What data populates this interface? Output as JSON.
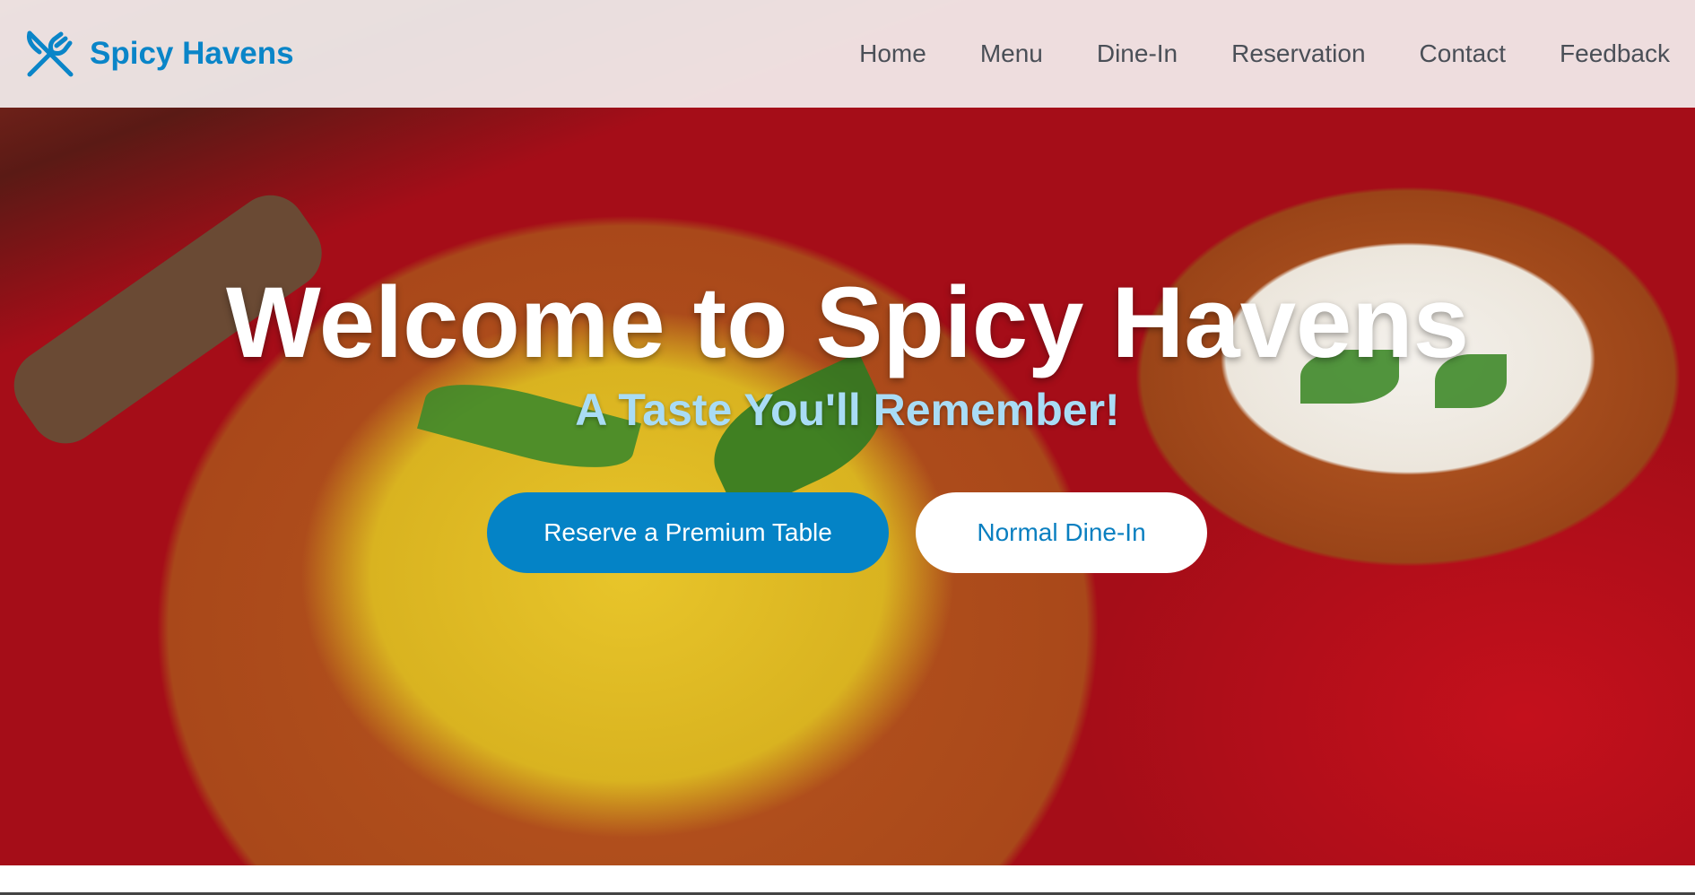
{
  "brand": {
    "name": "Spicy Havens",
    "icon": "utensils-icon",
    "color": "#0a85c8"
  },
  "nav": {
    "items": [
      {
        "label": "Home"
      },
      {
        "label": "Menu"
      },
      {
        "label": "Dine-In"
      },
      {
        "label": "Reservation"
      },
      {
        "label": "Contact"
      },
      {
        "label": "Feedback"
      }
    ]
  },
  "hero": {
    "title": "Welcome to Spicy Havens",
    "subtitle": "A Taste You'll Remember!",
    "primary_button": "Reserve a Premium Table",
    "secondary_button": "Normal Dine-In",
    "accent": "#0483c6"
  }
}
